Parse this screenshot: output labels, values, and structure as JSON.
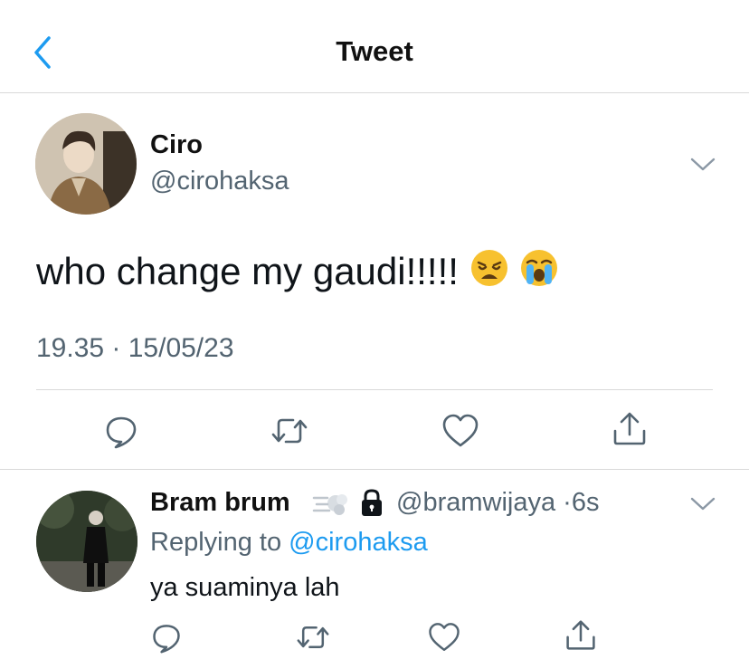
{
  "header": {
    "title": "Tweet"
  },
  "tweet": {
    "author_name": "Ciro",
    "author_handle": "@cirohaksa",
    "text": "who change my gaudi!!!!!",
    "emojis": [
      "weary-face-emoji",
      "loudly-crying-face-emoji"
    ],
    "timestamp": "19.35 · 15/05/23"
  },
  "reply": {
    "author_name": "Bram brum",
    "author_handle": "@bramwijaya",
    "separator": "·",
    "age": "6s",
    "replying_prefix": "Replying to",
    "replying_mention": "@cirohaksa",
    "text": "ya suaminya lah"
  },
  "icons": {
    "back": "chevron-left-icon",
    "more": "chevron-down-icon",
    "reply": "comment-icon",
    "retweet": "retweet-icon",
    "like": "heart-icon",
    "share": "share-icon",
    "name_emoji": "dash-emoji",
    "protected": "lock-icon"
  },
  "colors": {
    "accent": "#1d9bf0",
    "secondary_text": "#536471",
    "divider": "#d9d9d9"
  }
}
